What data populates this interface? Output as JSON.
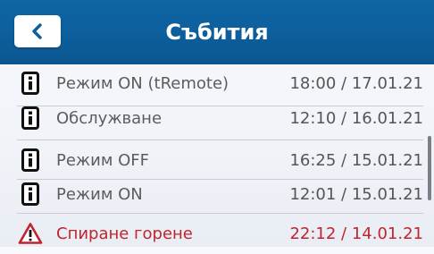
{
  "header": {
    "title": "Събития",
    "back_icon": "chevron-left-icon",
    "color": "#0d5e9c"
  },
  "events": [
    {
      "icon": "info-icon",
      "label": "Режим ON (tRemote)",
      "time": "18:00 / 17.01.21",
      "type": "info"
    },
    {
      "icon": "info-icon",
      "label": "Обслужване",
      "time": "12:10 / 16.01.21",
      "type": "info"
    },
    {
      "icon": "info-icon",
      "label": "Режим OFF",
      "time": "16:25 / 15.01.21",
      "type": "info"
    },
    {
      "icon": "info-icon",
      "label": "Режим ON",
      "time": "12:01 / 15.01.21",
      "type": "info"
    },
    {
      "icon": "warning-icon",
      "label": "Спиране горене",
      "time": "22:12 / 14.01.21",
      "type": "alarm"
    }
  ],
  "colors": {
    "alarm": "#c0242e",
    "text": "#5c5c5c"
  }
}
